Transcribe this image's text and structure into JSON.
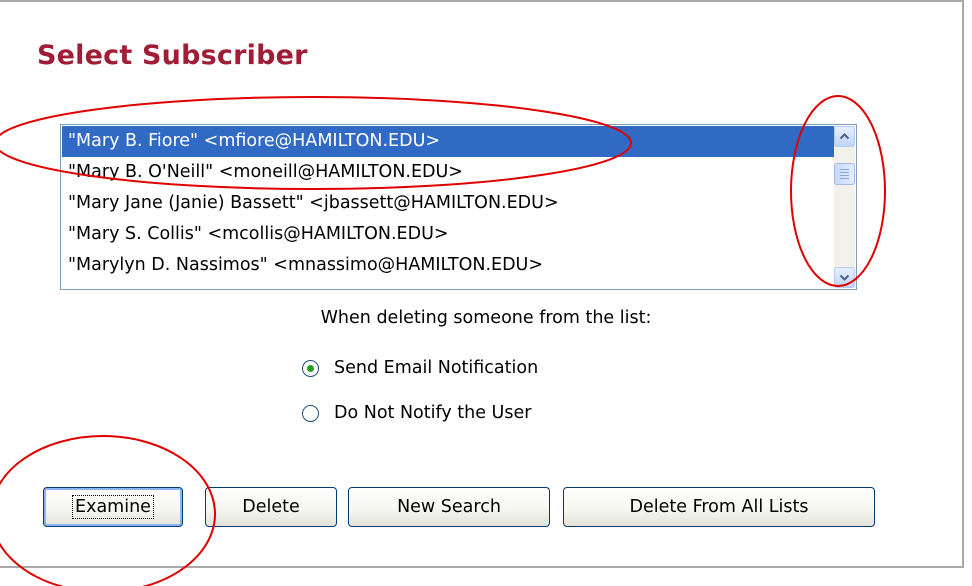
{
  "page": {
    "title": "Select Subscriber"
  },
  "subscriber_list": {
    "items": [
      {
        "label": "\"Mary B. Fiore\" <mfiore@HAMILTON.EDU>",
        "selected": true
      },
      {
        "label": "\"Mary B. O'Neill\" <moneill@HAMILTON.EDU>",
        "selected": false
      },
      {
        "label": "\"Mary Jane (Janie) Bassett\" <jbassett@HAMILTON.EDU>",
        "selected": false
      },
      {
        "label": "\"Mary S. Collis\" <mcollis@HAMILTON.EDU>",
        "selected": false
      },
      {
        "label": "\"Marylyn D. Nassimos\" <mnassimo@HAMILTON.EDU>",
        "selected": false
      }
    ],
    "scrollbar": {
      "up_icon": "chevron-up-icon",
      "down_icon": "chevron-down-icon"
    }
  },
  "delete_options": {
    "prompt": "When deleting someone from the list:",
    "send_email_label": "Send Email Notification",
    "do_not_notify_label": "Do Not Notify the User",
    "selected": "send_email"
  },
  "buttons": {
    "examine_label": "Examine",
    "delete_label": "Delete",
    "new_search_label": "New Search",
    "delete_all_label": "Delete From All Lists"
  },
  "colors": {
    "title": "#a01d36",
    "selection": "#316ac5",
    "annotation": "#e00000",
    "radio_dot": "#21a121"
  }
}
